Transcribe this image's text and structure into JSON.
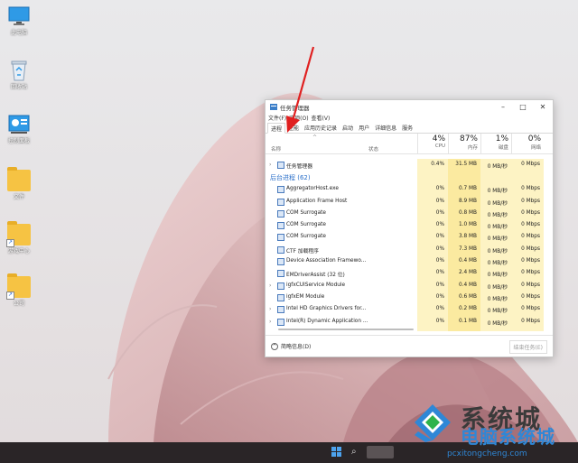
{
  "desktop": {
    "icons": [
      {
        "label": "此电脑",
        "kind": "pc"
      },
      {
        "label": "回收站",
        "kind": "recycle"
      },
      {
        "label": "控制面板",
        "kind": "control"
      },
      {
        "label": "文件",
        "kind": "folder"
      },
      {
        "label": "游戏中心",
        "kind": "folder-shortcut"
      },
      {
        "label": "公司",
        "kind": "folder-shortcut"
      }
    ]
  },
  "task_manager": {
    "title": "任务管理器",
    "window_buttons": [
      "–",
      "□",
      "✕"
    ],
    "menu": [
      "文件(F)",
      "选项(O)",
      "查看(V)"
    ],
    "tabs": [
      "进程",
      "性能",
      "应用历史记录",
      "启动",
      "用户",
      "详细信息",
      "服务"
    ],
    "active_tab": "进程",
    "columns": {
      "name": "名称",
      "status": "状态",
      "cpu": {
        "pct": "4%",
        "label": "CPU"
      },
      "mem": {
        "pct": "87%",
        "label": "内存"
      },
      "disk": {
        "pct": "1%",
        "label": "磁盘"
      },
      "net": {
        "pct": "0%",
        "label": "网络"
      }
    },
    "top_row": {
      "name": "任务管理器",
      "cpu": "0.4%",
      "mem": "31.5 MB",
      "disk": "0 MB/秒",
      "net": "0 Mbps"
    },
    "section_title": "后台进程 (62)",
    "processes": [
      {
        "name": "AggregatorHost.exe",
        "expand": false,
        "cpu": "0%",
        "mem": "0.7 MB",
        "disk": "0 MB/秒",
        "net": "0 Mbps"
      },
      {
        "name": "Application Frame Host",
        "expand": false,
        "cpu": "0%",
        "mem": "8.9 MB",
        "disk": "0 MB/秒",
        "net": "0 Mbps"
      },
      {
        "name": "COM Surrogate",
        "expand": false,
        "cpu": "0%",
        "mem": "0.8 MB",
        "disk": "0 MB/秒",
        "net": "0 Mbps"
      },
      {
        "name": "COM Surrogate",
        "expand": false,
        "cpu": "0%",
        "mem": "1.0 MB",
        "disk": "0 MB/秒",
        "net": "0 Mbps"
      },
      {
        "name": "COM Surrogate",
        "expand": false,
        "cpu": "0%",
        "mem": "3.8 MB",
        "disk": "0 MB/秒",
        "net": "0 Mbps"
      },
      {
        "name": "CTF 加载程序",
        "expand": false,
        "cpu": "0%",
        "mem": "7.3 MB",
        "disk": "0 MB/秒",
        "net": "0 Mbps"
      },
      {
        "name": "Device Association Framewo...",
        "expand": false,
        "cpu": "0%",
        "mem": "0.4 MB",
        "disk": "0 MB/秒",
        "net": "0 Mbps"
      },
      {
        "name": "EMDriverAssist (32 位)",
        "expand": false,
        "cpu": "0%",
        "mem": "2.4 MB",
        "disk": "0 MB/秒",
        "net": "0 Mbps"
      },
      {
        "name": "igfxCUIService Module",
        "expand": true,
        "cpu": "0%",
        "mem": "0.4 MB",
        "disk": "0 MB/秒",
        "net": "0 Mbps"
      },
      {
        "name": "igfxEM Module",
        "expand": false,
        "cpu": "0%",
        "mem": "0.6 MB",
        "disk": "0 MB/秒",
        "net": "0 Mbps"
      },
      {
        "name": "Intel HD Graphics Drivers for...",
        "expand": true,
        "cpu": "0%",
        "mem": "0.2 MB",
        "disk": "0 MB/秒",
        "net": "0 Mbps"
      },
      {
        "name": "Intel(R) Dynamic Application ...",
        "expand": true,
        "cpu": "0%",
        "mem": "0.1 MB",
        "disk": "0 MB/秒",
        "net": "0 Mbps"
      }
    ],
    "footer": {
      "less_details": "简略信息(D)",
      "end_task": "结束任务(E)"
    }
  },
  "taskbar": {
    "search_glyph": "⌕"
  },
  "watermark": {
    "big": "系统城",
    "brand": "电脑系统城",
    "url": "pcxitongcheng.com"
  },
  "colors": {
    "accent": "#2a6fc9",
    "heat": "#fdf3c4",
    "arrow": "#e02020",
    "taskbar": "#2a2527"
  }
}
